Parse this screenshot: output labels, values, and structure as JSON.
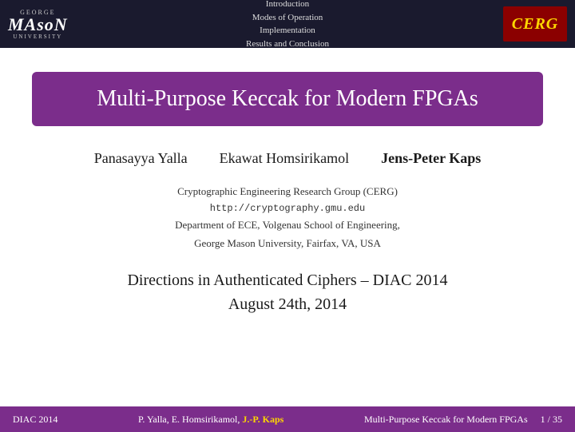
{
  "header": {
    "george_text": "GEORGE",
    "mason_text": "MAsoN",
    "university_text": "UNIVERSITY",
    "nav": {
      "items": [
        {
          "label": "Introduction",
          "active": false
        },
        {
          "label": "Modes of Operation",
          "active": false
        },
        {
          "label": "Implementation",
          "active": false
        },
        {
          "label": "Results and Conclusion",
          "active": false
        }
      ]
    },
    "cerg_label": "CERG"
  },
  "slide": {
    "title": "Multi-Purpose Keccak for Modern FPGAs",
    "authors": [
      {
        "name": "Panasayya Yalla",
        "bold": false
      },
      {
        "name": "Ekawat Homsirikamol",
        "bold": false
      },
      {
        "name": "Jens-Peter Kaps",
        "bold": true
      }
    ],
    "institution": {
      "group": "Cryptographic Engineering Research Group (CERG)",
      "url": "http://cryptography.gmu.edu",
      "dept": "Department of ECE, Volgenau School of Engineering,",
      "address": "George Mason University, Fairfax, VA, USA"
    },
    "conference": {
      "line1": "Directions in Authenticated Ciphers – DIAC 2014",
      "line2": "August 24th, 2014"
    }
  },
  "footer": {
    "left": "DIAC 2014",
    "center_normal": "P. Yalla, E. Homsirikamol,",
    "center_highlight": "J.-P. Kaps",
    "slide_title": "Multi-Purpose Keccak for Modern FPGAs",
    "page": "1 / 35"
  }
}
